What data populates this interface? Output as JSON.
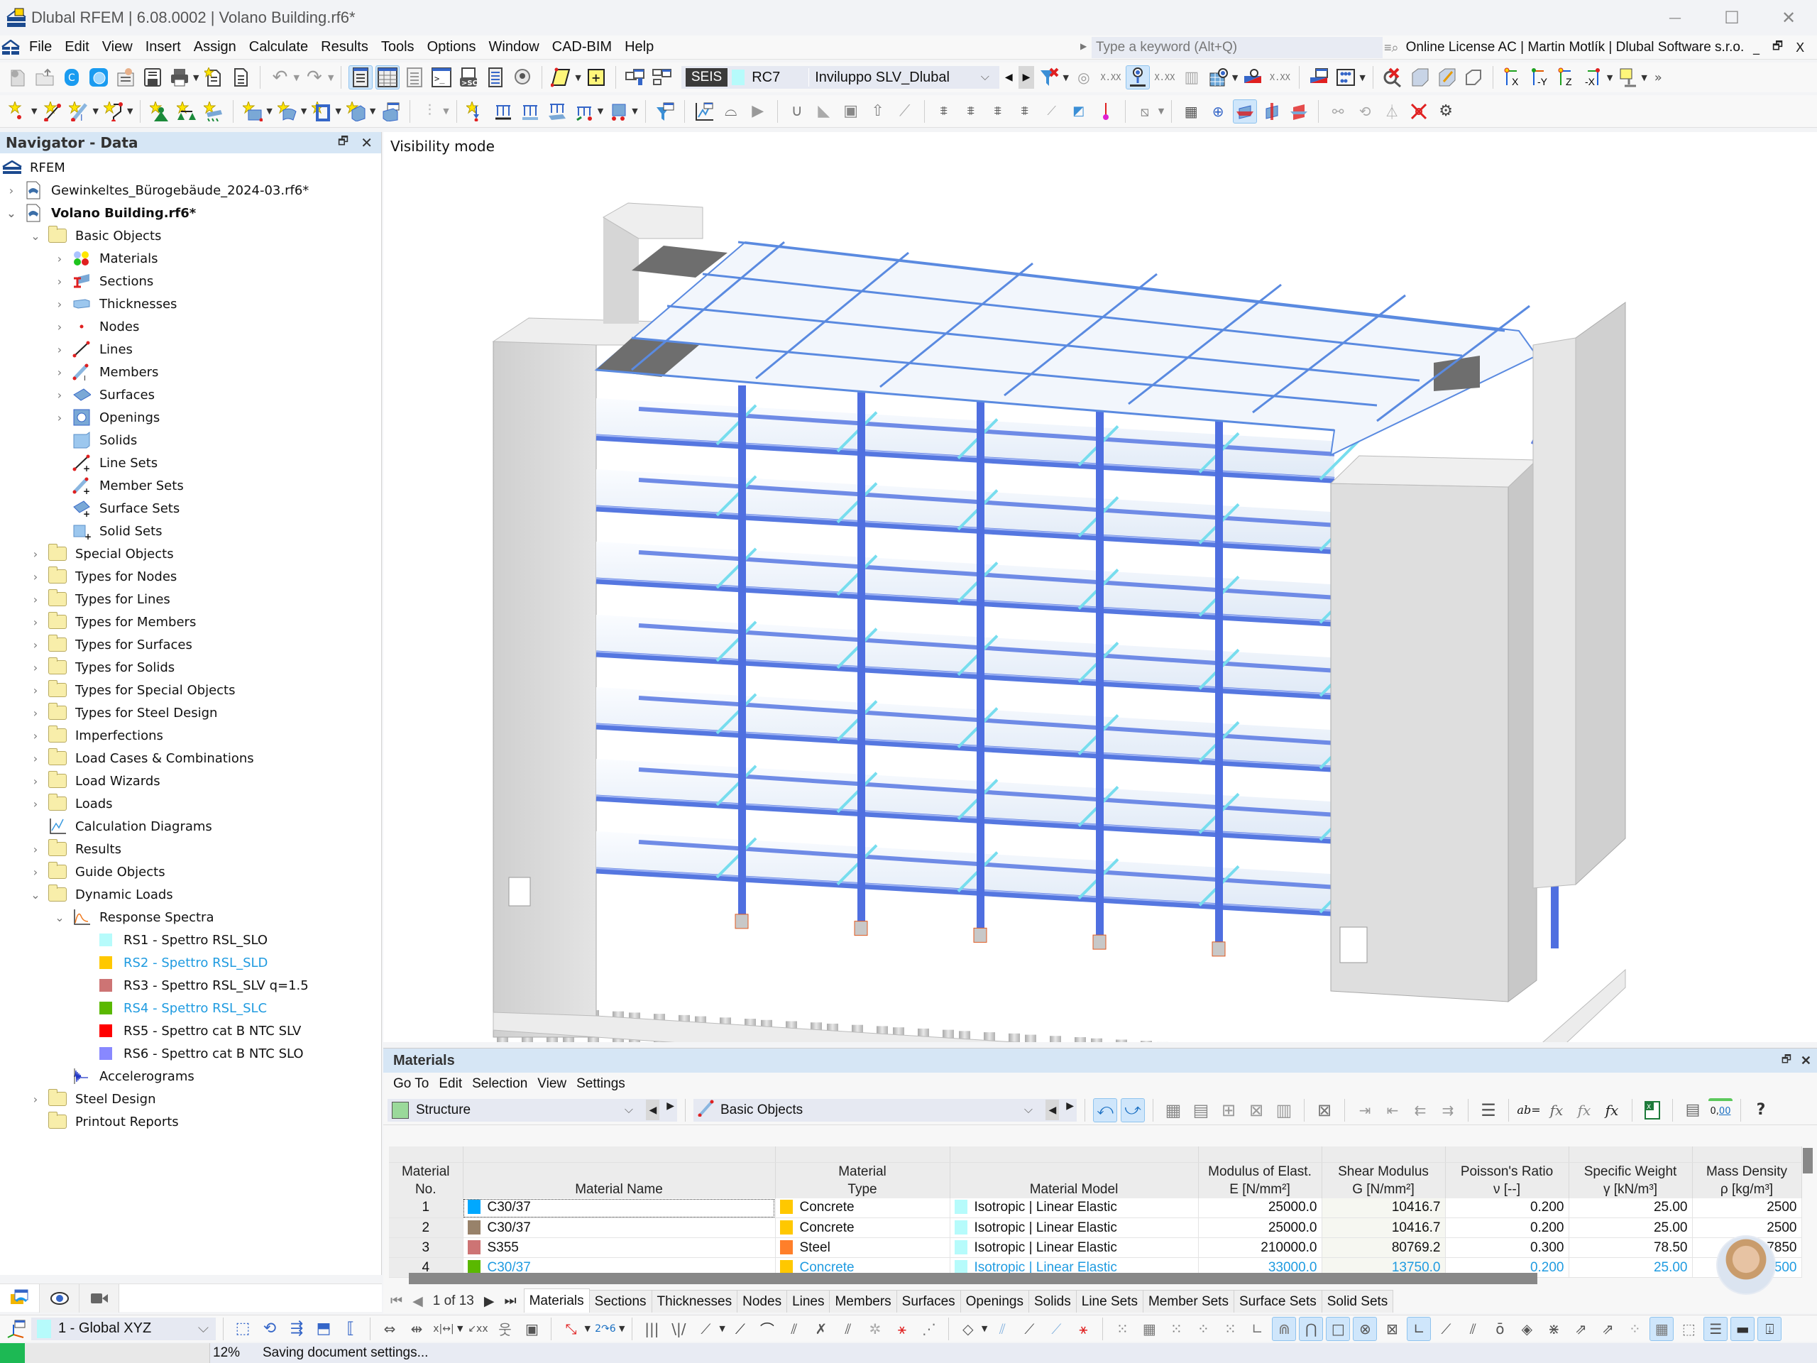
{
  "app": {
    "title": "Dlubal RFEM | 6.08.0002 | Volano Building.rf6*",
    "window_controls": {
      "minimize": "—",
      "maximize": "☐",
      "close": "✕"
    }
  },
  "menu": {
    "items": [
      "File",
      "Edit",
      "View",
      "Insert",
      "Assign",
      "Calculate",
      "Results",
      "Tools",
      "Options",
      "Window",
      "CAD-BIM",
      "Help"
    ],
    "search_placeholder": "Type a keyword (Alt+Q)",
    "license": "Online License AC | Martin Motlík | Dlubal Software s.r.o.",
    "inner_controls": {
      "minimize": "_",
      "restore": "🗗",
      "close": "X"
    }
  },
  "load_case_selector": {
    "tag": "SEIS",
    "tag_color": "#3a3a3a",
    "swatch_color": "#b6fbfb",
    "id": "RC7",
    "name": "Inviluppo SLV_Dlubal"
  },
  "navigator": {
    "title": "Navigator - Data",
    "root": "RFEM",
    "files": [
      {
        "name": "Gewinkeltes_Bürogebäude_2024-03.rf6*",
        "expanded": false,
        "bold": false
      },
      {
        "name": "Volano Building.rf6*",
        "expanded": true,
        "bold": true
      }
    ],
    "basic_objects": {
      "label": "Basic Objects",
      "children": [
        {
          "label": "Materials",
          "icon": "materials-icon",
          "expandable": true
        },
        {
          "label": "Sections",
          "icon": "sections-icon",
          "expandable": true
        },
        {
          "label": "Thicknesses",
          "icon": "thicknesses-icon",
          "expandable": true
        },
        {
          "label": "Nodes",
          "icon": "nodes-icon",
          "expandable": true
        },
        {
          "label": "Lines",
          "icon": "lines-icon",
          "expandable": true
        },
        {
          "label": "Members",
          "icon": "members-icon",
          "expandable": true
        },
        {
          "label": "Surfaces",
          "icon": "surfaces-icon",
          "expandable": true
        },
        {
          "label": "Openings",
          "icon": "openings-icon",
          "expandable": true
        },
        {
          "label": "Solids",
          "icon": "solids-icon",
          "expandable": false
        },
        {
          "label": "Line Sets",
          "icon": "line-sets-icon",
          "expandable": false
        },
        {
          "label": "Member Sets",
          "icon": "member-sets-icon",
          "expandable": false
        },
        {
          "label": "Surface Sets",
          "icon": "surface-sets-icon",
          "expandable": false
        },
        {
          "label": "Solid Sets",
          "icon": "solid-sets-icon",
          "expandable": false
        }
      ]
    },
    "folders": [
      {
        "label": "Special Objects"
      },
      {
        "label": "Types for Nodes"
      },
      {
        "label": "Types for Lines"
      },
      {
        "label": "Types for Members"
      },
      {
        "label": "Types for Surfaces"
      },
      {
        "label": "Types for Solids"
      },
      {
        "label": "Types for Special Objects"
      },
      {
        "label": "Types for Steel Design"
      },
      {
        "label": "Imperfections"
      },
      {
        "label": "Load Cases & Combinations"
      },
      {
        "label": "Load Wizards"
      },
      {
        "label": "Loads"
      }
    ],
    "calculation_diagrams": "Calculation Diagrams",
    "results": "Results",
    "guide_objects": "Guide Objects",
    "dynamic_loads": {
      "label": "Dynamic Loads",
      "response_spectra": {
        "label": "Response Spectra",
        "items": [
          {
            "label": "RS1 - Spettro RSL_SLO",
            "color": "#b6fbfb",
            "highlight": false
          },
          {
            "label": "RS2 - Spettro RSL_SLD",
            "color": "#ffc800",
            "highlight": true
          },
          {
            "label": "RS3 - Spettro RSL_SLV q=1.5",
            "color": "#cd7474",
            "highlight": false
          },
          {
            "label": "RS4 - Spettro RSL_SLC",
            "color": "#5ab800",
            "highlight": true
          },
          {
            "label": "RS5 - Spettro cat B NTC SLV",
            "color": "#ff0000",
            "highlight": false
          },
          {
            "label": "RS6 - Spettro cat B NTC SLO",
            "color": "#8888ff",
            "highlight": false
          }
        ]
      },
      "accelerograms": "Accelerograms"
    },
    "steel_design": "Steel Design",
    "printout_reports": "Printout Reports"
  },
  "viewport": {
    "mode_label": "Visibility mode"
  },
  "materials_panel": {
    "title": "Materials",
    "menu": [
      "Go To",
      "Edit",
      "Selection",
      "View",
      "Settings"
    ],
    "structure_combo": "Structure",
    "objects_combo": "Basic Objects",
    "columns": [
      {
        "line1": "Material",
        "line2": "No."
      },
      {
        "line1": "",
        "line2": "Material Name"
      },
      {
        "line1": "Material",
        "line2": "Type"
      },
      {
        "line1": "",
        "line2": "Material Model"
      },
      {
        "line1": "Modulus of Elast.",
        "line2": "E [N/mm²]"
      },
      {
        "line1": "Shear Modulus",
        "line2": "G [N/mm²]"
      },
      {
        "line1": "Poisson's Ratio",
        "line2": "ν [--]"
      },
      {
        "line1": "Specific Weight",
        "line2": "γ [kN/m³]"
      },
      {
        "line1": "Mass Density",
        "line2": "ρ [kg/m³]"
      }
    ],
    "rows": [
      {
        "no": "1",
        "name": "C30/37",
        "name_color": "#00a8ff",
        "type": "Concrete",
        "type_color": "#ffc800",
        "model": "Isotropic | Linear Elastic",
        "model_color": "#b6fbfb",
        "E": "25000.0",
        "G": "10416.7",
        "nu": "0.200",
        "gamma": "25.00",
        "rho": "2500",
        "highlight": false
      },
      {
        "no": "2",
        "name": "C30/37",
        "name_color": "#98826a",
        "type": "Concrete",
        "type_color": "#ffc800",
        "model": "Isotropic | Linear Elastic",
        "model_color": "#b6fbfb",
        "E": "25000.0",
        "G": "10416.7",
        "nu": "0.200",
        "gamma": "25.00",
        "rho": "2500",
        "highlight": false
      },
      {
        "no": "3",
        "name": "S355",
        "name_color": "#cd7474",
        "type": "Steel",
        "type_color": "#ff7f2a",
        "model": "Isotropic | Linear Elastic",
        "model_color": "#b6fbfb",
        "E": "210000.0",
        "G": "80769.2",
        "nu": "0.300",
        "gamma": "78.50",
        "rho": "7850",
        "highlight": false
      },
      {
        "no": "4",
        "name": "C30/37",
        "name_color": "#5ab800",
        "type": "Concrete",
        "type_color": "#ffc800",
        "model": "Isotropic | Linear Elastic",
        "model_color": "#b6fbfb",
        "E": "33000.0",
        "G": "13750.0",
        "nu": "0.200",
        "gamma": "25.00",
        "rho": "2500",
        "highlight": true
      }
    ],
    "pager": "1 of 13",
    "tabs": [
      "Materials",
      "Sections",
      "Thicknesses",
      "Nodes",
      "Lines",
      "Members",
      "Surfaces",
      "Openings",
      "Solids",
      "Line Sets",
      "Member Sets",
      "Surface Sets",
      "Solid Sets"
    ],
    "active_tab": "Materials"
  },
  "coordinate_system": {
    "swatch_color": "#b6fbfb",
    "label": "1 - Global XYZ"
  },
  "status": {
    "progress_percent": 12,
    "progress_label": "12%",
    "message": "Saving document settings..."
  }
}
